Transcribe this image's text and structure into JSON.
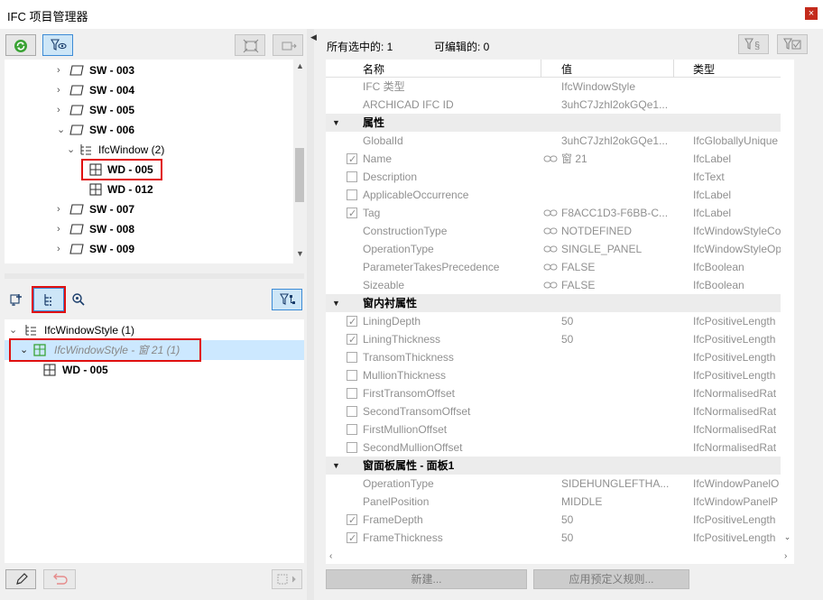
{
  "window": {
    "title": "IFC 项目管理器",
    "close": "×"
  },
  "tree_top": {
    "items": [
      {
        "label": "SW - 003",
        "level": 1,
        "expanded": false
      },
      {
        "label": "SW - 004",
        "level": 1,
        "expanded": false
      },
      {
        "label": "SW - 005",
        "level": 1,
        "expanded": false
      },
      {
        "label": "SW - 006",
        "level": 1,
        "expanded": true
      },
      {
        "label": "IfcWindow (2)",
        "level": 2,
        "expanded": true
      },
      {
        "label": "WD - 005",
        "level": 3,
        "highlighted": true
      },
      {
        "label": "WD - 012",
        "level": 3
      },
      {
        "label": "SW - 007",
        "level": 1,
        "expanded": false
      },
      {
        "label": "SW - 008",
        "level": 1,
        "expanded": false
      },
      {
        "label": "SW - 009",
        "level": 1,
        "expanded": false
      }
    ]
  },
  "tree_bottom": {
    "items": [
      {
        "label": "IfcWindowStyle (1)"
      },
      {
        "label": "IfcWindowStyle - 窗 21 (1)",
        "selected": true
      },
      {
        "label": "WD - 005"
      }
    ]
  },
  "header": {
    "selected_label": "所有选中的: 1",
    "editable_label": "可编辑的: 0"
  },
  "columns": {
    "name": "名称",
    "value": "值",
    "type": "类型"
  },
  "properties": [
    {
      "name": "IFC 类型",
      "value": "IfcWindowStyle",
      "type": ""
    },
    {
      "name": "ARCHICAD IFC ID",
      "value": "3uhC7Jzhl2okGQe1...",
      "type": ""
    },
    {
      "group": "属性"
    },
    {
      "name": "GlobalId",
      "value": "3uhC7Jzhl2okGQe1...",
      "type": "IfcGloballyUnique"
    },
    {
      "name": "Name",
      "value": "窗 21",
      "type": "IfcLabel",
      "check": "checked",
      "link": true
    },
    {
      "name": "Description",
      "value": "",
      "type": "IfcText",
      "check": "unchecked"
    },
    {
      "name": "ApplicableOccurrence",
      "value": "",
      "type": "IfcLabel",
      "check": "unchecked"
    },
    {
      "name": "Tag",
      "value": "F8ACC1D3-F6BB-C...",
      "type": "IfcLabel",
      "check": "checked",
      "link": true
    },
    {
      "name": "ConstructionType",
      "value": "NOTDEFINED",
      "type": "IfcWindowStyleCo",
      "link": true
    },
    {
      "name": "OperationType",
      "value": "SINGLE_PANEL",
      "type": "IfcWindowStyleOp",
      "link": true
    },
    {
      "name": "ParameterTakesPrecedence",
      "value": "FALSE",
      "type": "IfcBoolean",
      "link": true
    },
    {
      "name": "Sizeable",
      "value": "FALSE",
      "type": "IfcBoolean",
      "link": true
    },
    {
      "group": "窗内衬属性"
    },
    {
      "name": "LiningDepth",
      "value": "50",
      "type": "IfcPositiveLength",
      "check": "checked"
    },
    {
      "name": "LiningThickness",
      "value": "50",
      "type": "IfcPositiveLength",
      "check": "checked"
    },
    {
      "name": "TransomThickness",
      "value": "",
      "type": "IfcPositiveLength",
      "check": "unchecked"
    },
    {
      "name": "MullionThickness",
      "value": "",
      "type": "IfcPositiveLength",
      "check": "unchecked"
    },
    {
      "name": "FirstTransomOffset",
      "value": "",
      "type": "IfcNormalisedRat",
      "check": "unchecked"
    },
    {
      "name": "SecondTransomOffset",
      "value": "",
      "type": "IfcNormalisedRat",
      "check": "unchecked"
    },
    {
      "name": "FirstMullionOffset",
      "value": "",
      "type": "IfcNormalisedRat",
      "check": "unchecked"
    },
    {
      "name": "SecondMullionOffset",
      "value": "",
      "type": "IfcNormalisedRat",
      "check": "unchecked"
    },
    {
      "group": "窗面板属性 - 面板1"
    },
    {
      "name": "OperationType",
      "value": "SIDEHUNGLEFTHA...",
      "type": "IfcWindowPanelO"
    },
    {
      "name": "PanelPosition",
      "value": "MIDDLE",
      "type": "IfcWindowPanelP"
    },
    {
      "name": "FrameDepth",
      "value": "50",
      "type": "IfcPositiveLength",
      "check": "checked"
    },
    {
      "name": "FrameThickness",
      "value": "50",
      "type": "IfcPositiveLength",
      "check": "checked"
    }
  ],
  "buttons": {
    "new_label": "新建...",
    "apply_rules_label": "应用预定义规则..."
  },
  "colors": {
    "highlight_border": "#e01010",
    "selection": "#cce8ff",
    "toggle_on": "#cde6f7",
    "group_row": "#ececec"
  }
}
